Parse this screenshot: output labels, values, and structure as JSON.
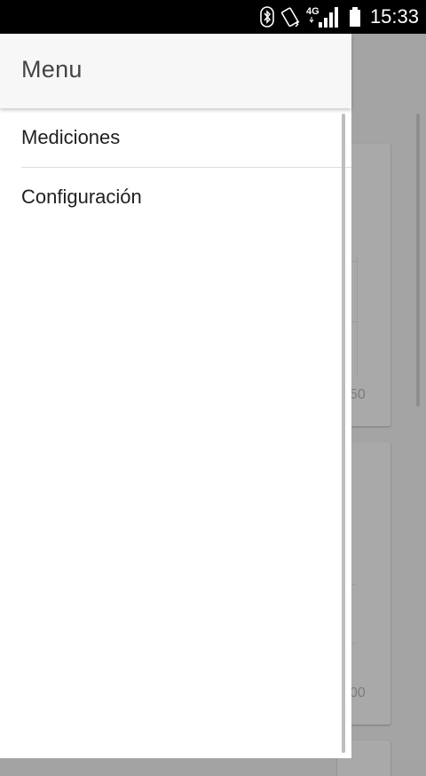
{
  "status_bar": {
    "time": "15:33",
    "network": "4G",
    "icons": [
      "bluetooth-icon",
      "vibrate-icon",
      "signal-icon",
      "battery-icon"
    ]
  },
  "drawer": {
    "title": "Menu",
    "items": [
      {
        "label": "Mediciones"
      },
      {
        "label": "Configuración"
      }
    ]
  },
  "background": {
    "card_1_tick": "50",
    "card_2_tick": "00"
  },
  "colors": {
    "status_bar": "#000000",
    "drawer_bg": "#ffffff",
    "header_bg": "#f7f7f7",
    "scrim": "#a4a4a4"
  }
}
